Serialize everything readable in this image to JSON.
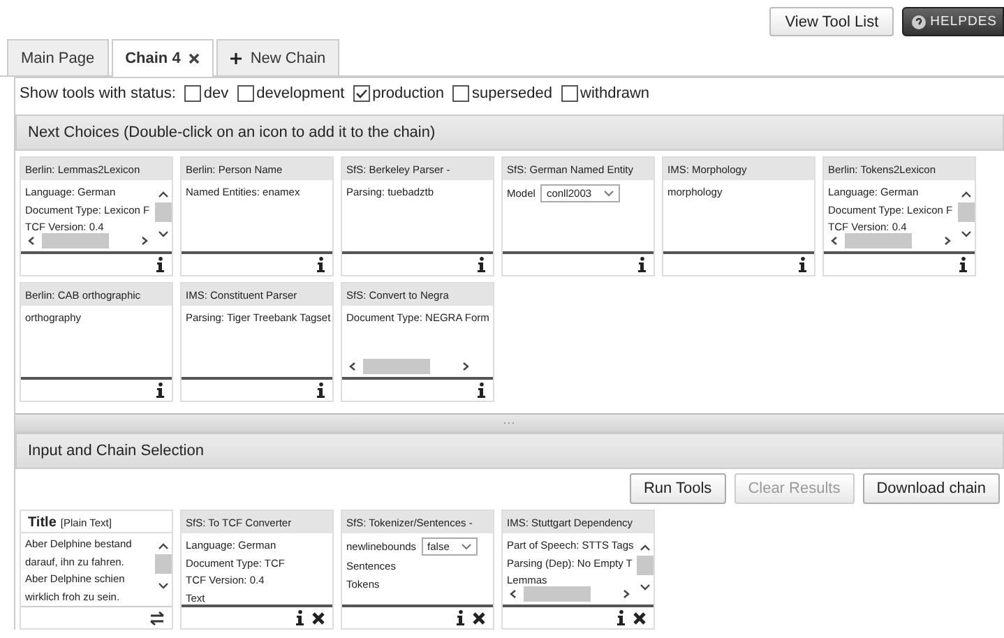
{
  "top_buttons": [
    {
      "label": "View Tool List",
      "kind": "plain"
    },
    {
      "label": "HELPDES",
      "kind": "help"
    }
  ],
  "tabs": [
    {
      "label": "Main Page",
      "selected": false,
      "kind": "page"
    },
    {
      "label": "Chain 4",
      "selected": true,
      "kind": "closable"
    },
    {
      "label": "New Chain",
      "selected": false,
      "kind": "add"
    }
  ],
  "status_filter": {
    "label": "Show tools with status:",
    "options": [
      {
        "label": "dev",
        "checked": false
      },
      {
        "label": "development",
        "checked": false
      },
      {
        "label": "production",
        "checked": true
      },
      {
        "label": "superseded",
        "checked": false
      },
      {
        "label": "withdrawn",
        "checked": false
      }
    ]
  },
  "next_choices": {
    "title": "Next Choices (Double-click on an icon to add it to the chain)",
    "tools": [
      {
        "title": "Berlin: Lemmas2Lexicon",
        "kind": "scroll",
        "lines": [
          "Language: German",
          "Document Type: Lexicon F",
          "TCF Version: 0.4"
        ]
      },
      {
        "title": "Berlin: Person Name",
        "kind": "text",
        "lines": [
          "Named Entities: enamex"
        ]
      },
      {
        "title": "SfS: Berkeley Parser -",
        "kind": "text",
        "lines": [
          "Parsing: tuebadztb"
        ]
      },
      {
        "title": "SfS: German Named Entity",
        "kind": "select",
        "field_label": "Model",
        "value": "conll2003"
      },
      {
        "title": "IMS: Morphology",
        "kind": "text",
        "lines": [
          "morphology"
        ]
      },
      {
        "title": "Berlin: Tokens2Lexicon",
        "kind": "scroll",
        "lines": [
          "Language: German",
          "Document Type: Lexicon F",
          "TCF Version: 0.4"
        ]
      },
      {
        "title": "Berlin: CAB orthographic",
        "kind": "text",
        "lines": [
          "orthography"
        ]
      },
      {
        "title": "IMS: Constituent Parser",
        "kind": "text",
        "lines": [
          "Parsing: Tiger Treebank Tagset"
        ]
      },
      {
        "title": "SfS: Convert to Negra",
        "kind": "hscroll",
        "lines": [
          "Document Type: NEGRA Form"
        ]
      }
    ]
  },
  "chain_section": {
    "title": "Input and Chain Selection",
    "buttons": [
      {
        "label": "Run Tools",
        "disabled": false
      },
      {
        "label": "Clear Results",
        "disabled": true
      },
      {
        "label": "Download chain",
        "disabled": false
      }
    ],
    "input": {
      "title": "Title",
      "format": "[Plain Text]",
      "lines": [
        "Aber Delphine bestand",
        "darauf, ihn zu fahren.",
        "Aber Delphine schien",
        "wirklich froh zu sein."
      ]
    },
    "tools": [
      {
        "title": "SfS: To TCF Converter",
        "kind": "text",
        "lines": [
          "Language: German",
          "Document Type: TCF",
          "TCF Version: 0.4",
          "Text"
        ]
      },
      {
        "title": "SfS: Tokenizer/Sentences -",
        "kind": "select",
        "field_label": "newlinebounds",
        "value": "false",
        "lines": [
          "Sentences",
          "Tokens"
        ]
      },
      {
        "title": "IMS: Stuttgart Dependency",
        "kind": "scroll",
        "lines": [
          "Part of Speech: STTS Tags",
          "Parsing (Dep): No Empty T",
          "Lemmas"
        ]
      }
    ]
  }
}
